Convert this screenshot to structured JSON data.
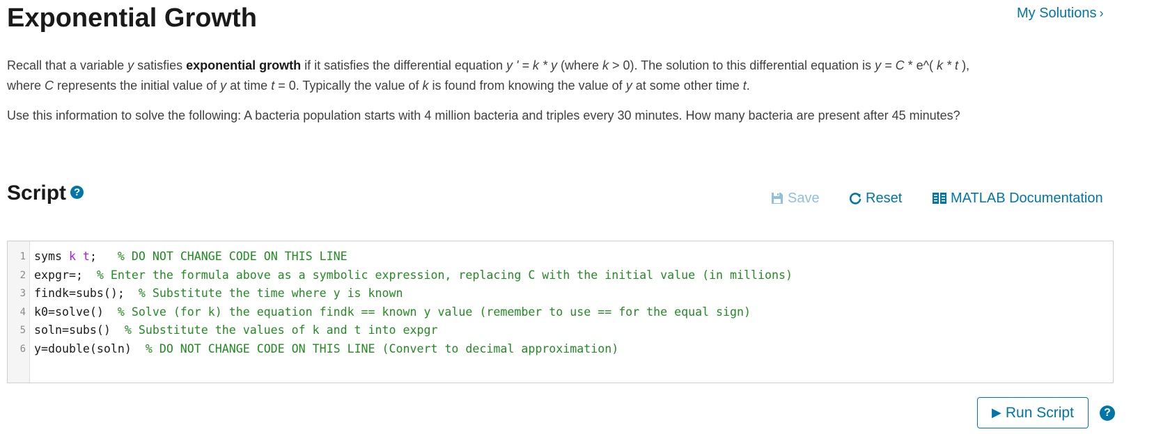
{
  "title": "Exponential Growth",
  "my_solutions": "My Solutions",
  "description": {
    "p1_a": "Recall that a variable ",
    "p1_y1": "y",
    "p1_b": " satisfies ",
    "p1_bold": "exponential growth",
    "p1_c": " if it satisfies the differential equation ",
    "p1_eq1": "y ' = k * y",
    "p1_d": " (where ",
    "p1_k1": "k",
    "p1_e": " > 0). The solution to this differential equation is ",
    "p1_eq2a": "y = C",
    "p1_f": " * e^( ",
    "p1_eq2b": "k * t",
    "p1_g": " ),",
    "p1_h": "where ",
    "p1_C": "C",
    "p1_i": " represents the initial value of ",
    "p1_y2": "y",
    "p1_j": " at time ",
    "p1_t1": "t",
    "p1_k": " = 0. Typically the value of ",
    "p1_k2": "k",
    "p1_l": " is found from knowing the value of ",
    "p1_y3": "y",
    "p1_m": " at some other time ",
    "p1_t2": "t",
    "p1_n": ".",
    "p2": "Use this information to solve the following: A bacteria population starts with 4 million bacteria and triples every 30 minutes. How many bacteria are present after 45 minutes?"
  },
  "script_heading": "Script",
  "toolbar": {
    "save_label": "Save",
    "reset_label": "Reset",
    "docs_label": "MATLAB Documentation"
  },
  "code_lines": [
    {
      "num": "1",
      "pre": "syms ",
      "kw": "k t",
      "post": ";   ",
      "comment": "% DO NOT CHANGE CODE ON THIS LINE"
    },
    {
      "num": "2",
      "pre": "expgr=;  ",
      "kw": "",
      "post": "",
      "comment": "% Enter the formula above as a symbolic expression, replacing C with the initial value (in millions)"
    },
    {
      "num": "3",
      "pre": "findk=subs();  ",
      "kw": "",
      "post": "",
      "comment": "% Substitute the time where y is known"
    },
    {
      "num": "4",
      "pre": "k0=solve()  ",
      "kw": "",
      "post": "",
      "comment": "% Solve (for k) the equation findk == known y value (remember to use == for the equal sign)"
    },
    {
      "num": "5",
      "pre": "soln=subs()  ",
      "kw": "",
      "post": "",
      "comment": "% Substitute the values of k and t into expgr"
    },
    {
      "num": "6",
      "pre": "y=double(soln)  ",
      "kw": "",
      "post": "",
      "comment": "% DO NOT CHANGE CODE ON THIS LINE (Convert to decimal approximation)"
    }
  ],
  "run_button_label": "Run Script",
  "icons": {
    "help": "?",
    "save": "floppy-disk-icon",
    "reset": "refresh-icon",
    "docs": "book-icon",
    "run": "play-icon"
  },
  "colors": {
    "accent": "#0076a8",
    "disabled": "#8fc2d9",
    "keyword": "#a020f0",
    "comment": "#228b22"
  }
}
